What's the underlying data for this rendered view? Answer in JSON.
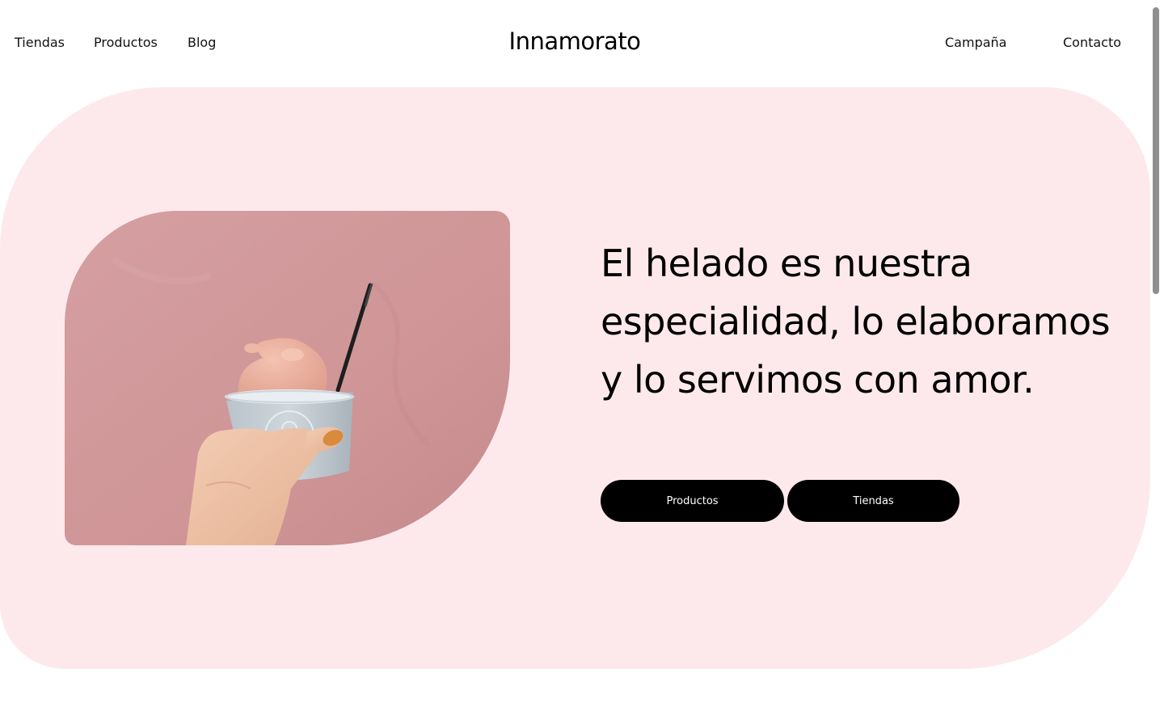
{
  "nav": {
    "left": [
      "Tiendas",
      "Productos",
      "Blog"
    ],
    "right": [
      "Campaña",
      "Contacto"
    ]
  },
  "brand": {
    "logo": "Innamorato"
  },
  "hero": {
    "headline": "El helado es nuestra especialidad, lo elaboramos y lo servimos con amor.",
    "buttons": [
      "Productos",
      "Tiendas"
    ],
    "image": {
      "subject": "hand holding ice cream cup against pink wall"
    }
  },
  "colors": {
    "hero_background": "#fde9ec",
    "button_background": "#000000",
    "button_text": "#ffffff",
    "photo_wall": "#d29a9c"
  }
}
